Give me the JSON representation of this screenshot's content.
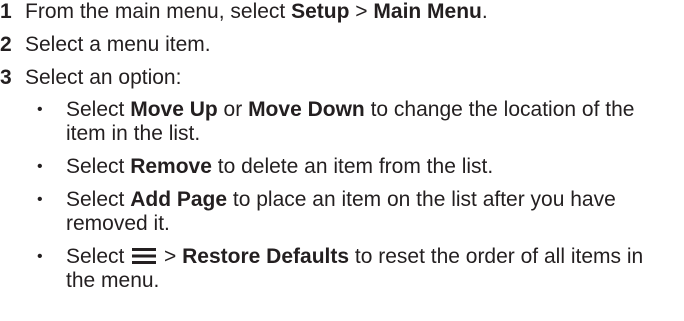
{
  "steps": [
    {
      "number": "1",
      "pre": "From the main menu, select ",
      "b1": "Setup",
      "mid": " > ",
      "b2": "Main Menu",
      "post": "."
    },
    {
      "number": "2",
      "text": "Select a menu item."
    },
    {
      "number": "3",
      "text": "Select an option:"
    }
  ],
  "options": [
    {
      "bullet": "•",
      "pre": "Select ",
      "b1": "Move Up",
      "mid": " or ",
      "b2": "Move Down",
      "post": " to change the location of the item in the list."
    },
    {
      "bullet": "•",
      "pre": "Select ",
      "b1": "Remove",
      "post": " to delete an item from the list."
    },
    {
      "bullet": "•",
      "pre": "Select ",
      "b1": "Add Page",
      "post": " to place an item on the list after you have removed it."
    },
    {
      "bullet": "•",
      "pre": "Select ",
      "icon": "menu-icon",
      "mid": " > ",
      "b1": "Restore Defaults",
      "post": " to reset the order of all items in the menu."
    }
  ]
}
